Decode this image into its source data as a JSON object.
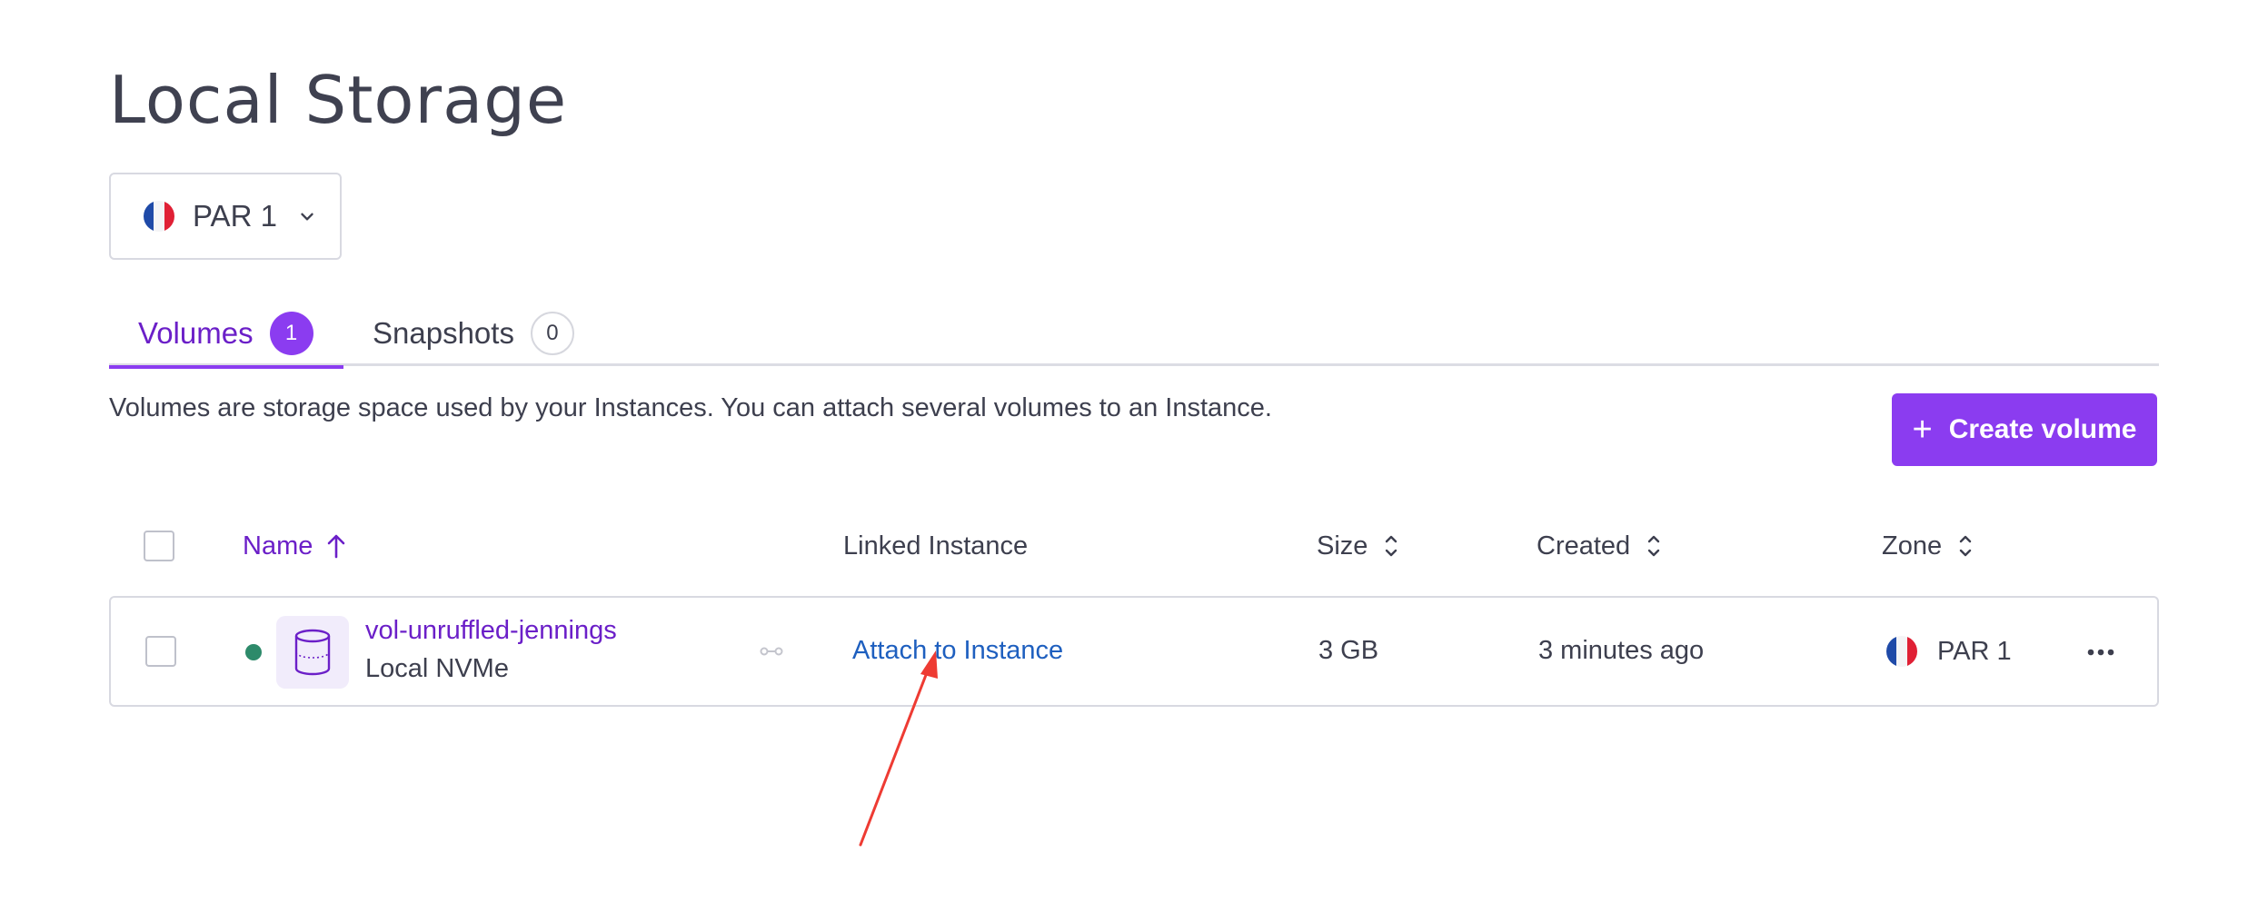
{
  "page": {
    "title": "Local Storage"
  },
  "zone_selector": {
    "label": "PAR 1",
    "flag_icon": "france-flag-icon"
  },
  "tabs": [
    {
      "label": "Volumes",
      "count": "1",
      "active": true
    },
    {
      "label": "Snapshots",
      "count": "0",
      "active": false
    }
  ],
  "description": "Volumes are storage space used by your Instances. You can attach several volumes to an Instance.",
  "create_button": {
    "label": "Create volume",
    "icon": "plus-icon"
  },
  "table": {
    "headers": {
      "name": "Name",
      "linked_instance": "Linked Instance",
      "size": "Size",
      "created": "Created",
      "zone": "Zone"
    },
    "sort": {
      "column": "name",
      "direction": "ascending"
    },
    "rows": [
      {
        "name": "vol-unruffled-jennings",
        "type": "Local NVMe",
        "status_color": "#2d8a6a",
        "linked_instance_action": "Attach to Instance",
        "size": "3 GB",
        "created": "3 minutes ago",
        "zone": "PAR 1"
      }
    ]
  },
  "colors": {
    "accent": "#8b3cf0",
    "accent_text": "#6b1fc8",
    "link": "#1e5fbf",
    "annotation_arrow": "#ee3b33"
  }
}
